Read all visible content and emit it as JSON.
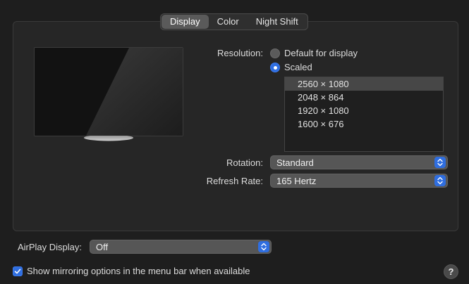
{
  "tabs": [
    {
      "label": "Display",
      "active": true
    },
    {
      "label": "Color",
      "active": false
    },
    {
      "label": "Night Shift",
      "active": false
    }
  ],
  "resolution": {
    "label": "Resolution:",
    "options": [
      {
        "label": "Default for display",
        "selected": false
      },
      {
        "label": "Scaled",
        "selected": true
      }
    ],
    "list": [
      {
        "label": "2560 × 1080",
        "selected": true
      },
      {
        "label": "2048 × 864",
        "selected": false
      },
      {
        "label": "1920 × 1080",
        "selected": false
      },
      {
        "label": "1600 × 676",
        "selected": false
      }
    ]
  },
  "rotation": {
    "label": "Rotation:",
    "value": "Standard"
  },
  "refresh_rate": {
    "label": "Refresh Rate:",
    "value": "165 Hertz"
  },
  "airplay": {
    "label": "AirPlay Display:",
    "value": "Off"
  },
  "mirroring": {
    "label": "Show mirroring options in the menu bar when available",
    "checked": true
  },
  "help": {
    "glyph": "?"
  },
  "colors": {
    "accent": "#2f6ee0",
    "background": "#1e1e1e",
    "popup": "#565656"
  }
}
